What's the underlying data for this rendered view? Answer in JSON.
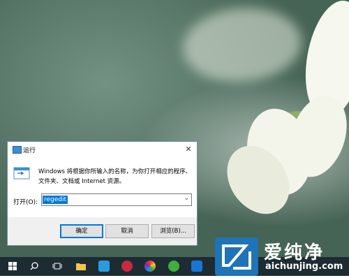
{
  "dialog": {
    "title": "运行",
    "close_symbol": "✕",
    "description": "Windows 将根据你所输入的名称，为你打开相应的程序、文件夹、文档或 Internet 资源。",
    "open_label": "打开(O):",
    "input_value": "regedit",
    "buttons": {
      "ok": "确定",
      "cancel": "取消",
      "browse": "浏览(B)..."
    }
  },
  "taskbar": {
    "items": [
      "windows-start",
      "search",
      "task-view",
      "file-explorer",
      "store",
      "app-red",
      "app-colorful",
      "app-green",
      "app-blue"
    ]
  },
  "watermark": {
    "big_text": "爱纯净",
    "small_text": "aichunjing.com"
  },
  "colors": {
    "accent": "#0078d7",
    "taskbar": "#1d2b33",
    "logo": "#1f73b7"
  }
}
